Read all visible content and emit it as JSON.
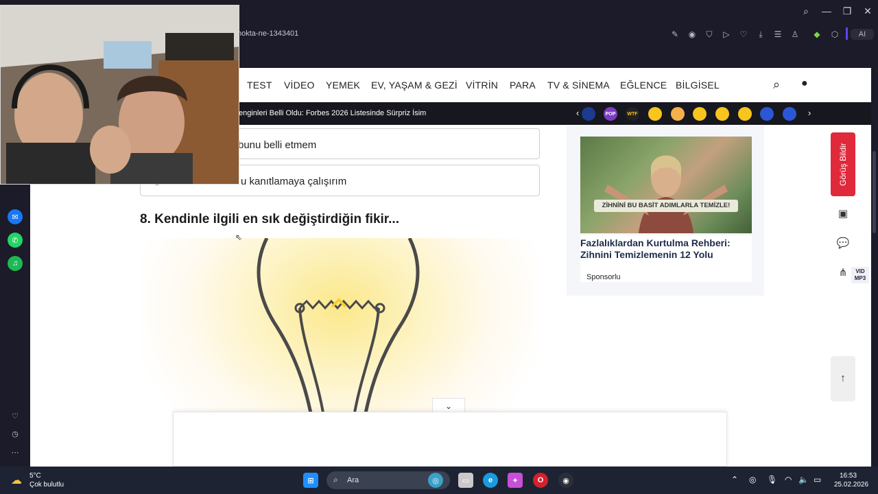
{
  "browser": {
    "url_fragment": "nokta-ne-1343401",
    "ai_label": "AI",
    "colors": {
      "chrome_bg": "#1b1b29"
    }
  },
  "nav": {
    "items": [
      "TEST",
      "VİDEO",
      "YEMEK",
      "EV, YAŞAM & GEZİ",
      "VİTRİN",
      "PARA",
      "TV & SİNEMA",
      "EĞLENCE",
      "BİLGİSEL"
    ]
  },
  "ticker": {
    "headline": "enginleri Belli Oldu: Forbes 2026 Listesinde Sürpriz İsim",
    "badges": [
      "",
      "POP",
      "WTF",
      "",
      "",
      "",
      "",
      "",
      "",
      "",
      ""
    ]
  },
  "quiz": {
    "options": [
      "bunu belli etmem",
      "kanıtlamaya çalışırım"
    ],
    "option_partial": "u kanıtlamaya çalışırım",
    "question": "8. Kendinle ilgili en sık değiştirdiğin fikir..."
  },
  "ad": {
    "badge": "ZİHNİNİ BU BASİT ADIMLARLA TEMİZLE!",
    "title": "Fazlalıklardan Kurtulma Rehberi: Zihnini Temizlemenin 12 Yolu",
    "sponsor": "Sponsorlu"
  },
  "side_actions": {
    "feedback": "Görüş Bildir",
    "vid_mp3_top": "VID",
    "vid_mp3_bottom": "MP3"
  },
  "taskbar": {
    "weather_temp": "5°C",
    "weather_desc": "Çok bulutlu",
    "search_placeholder": "Ara",
    "time": "16:53",
    "date": "25.02.2026"
  }
}
